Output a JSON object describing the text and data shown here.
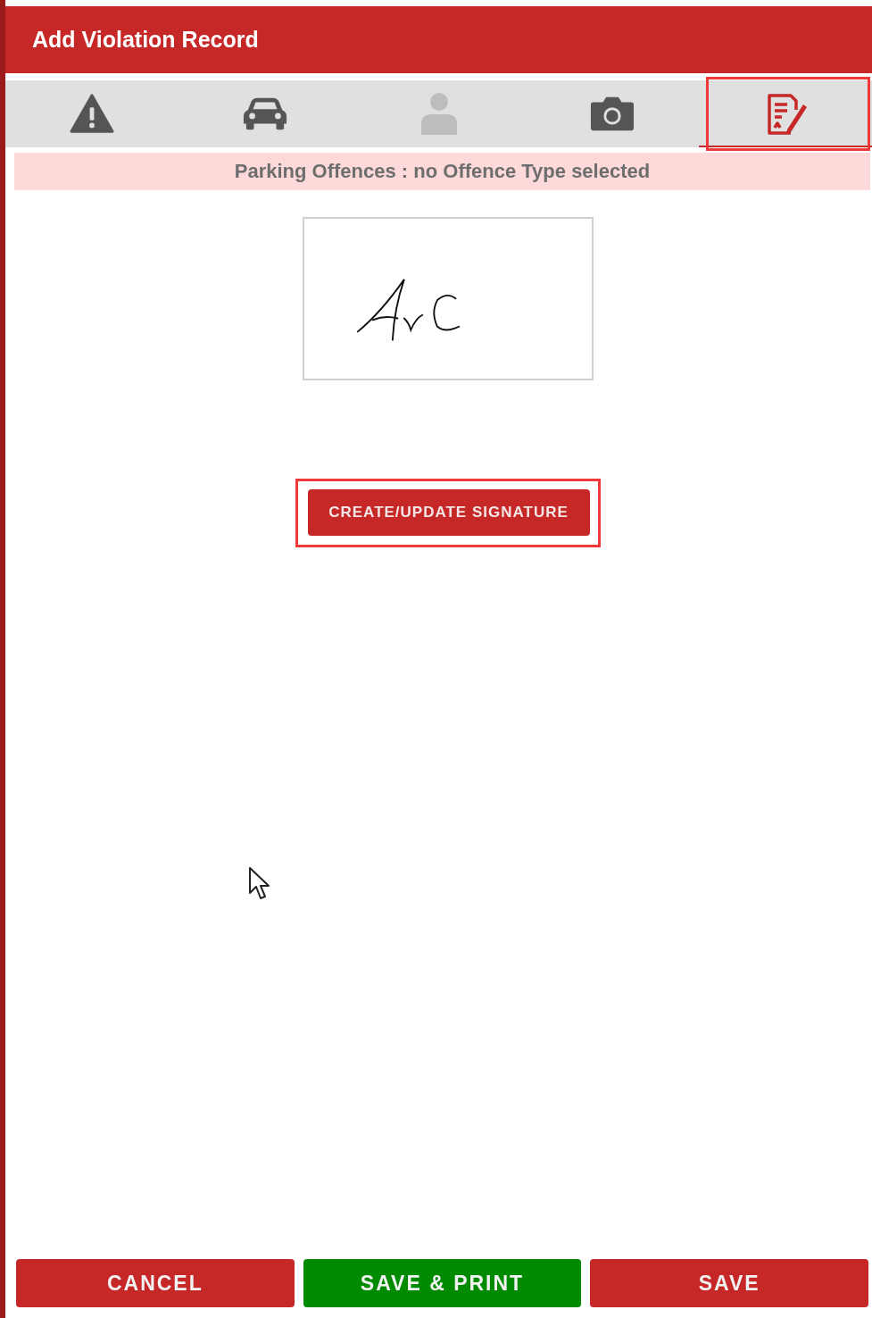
{
  "window": {
    "title": "Add Violation Record"
  },
  "tabs": [
    {
      "kind": "warning",
      "selected": false,
      "disabled": false,
      "highlighted": false
    },
    {
      "kind": "car",
      "selected": false,
      "disabled": false,
      "highlighted": false
    },
    {
      "kind": "person",
      "selected": false,
      "disabled": true,
      "highlighted": false
    },
    {
      "kind": "camera",
      "selected": false,
      "disabled": false,
      "highlighted": false
    },
    {
      "kind": "signature",
      "selected": true,
      "disabled": false,
      "highlighted": true
    }
  ],
  "banner": "Parking Offences : no Offence Type selected",
  "signature_button": {
    "label": "CREATE/UPDATE SIGNATURE",
    "highlighted": true
  },
  "buttons": [
    {
      "label": "CANCEL",
      "color": "#c62828"
    },
    {
      "label": "SAVE & PRINT",
      "color": "#008a00"
    },
    {
      "label": "SAVE",
      "color": "#c62828"
    }
  ]
}
